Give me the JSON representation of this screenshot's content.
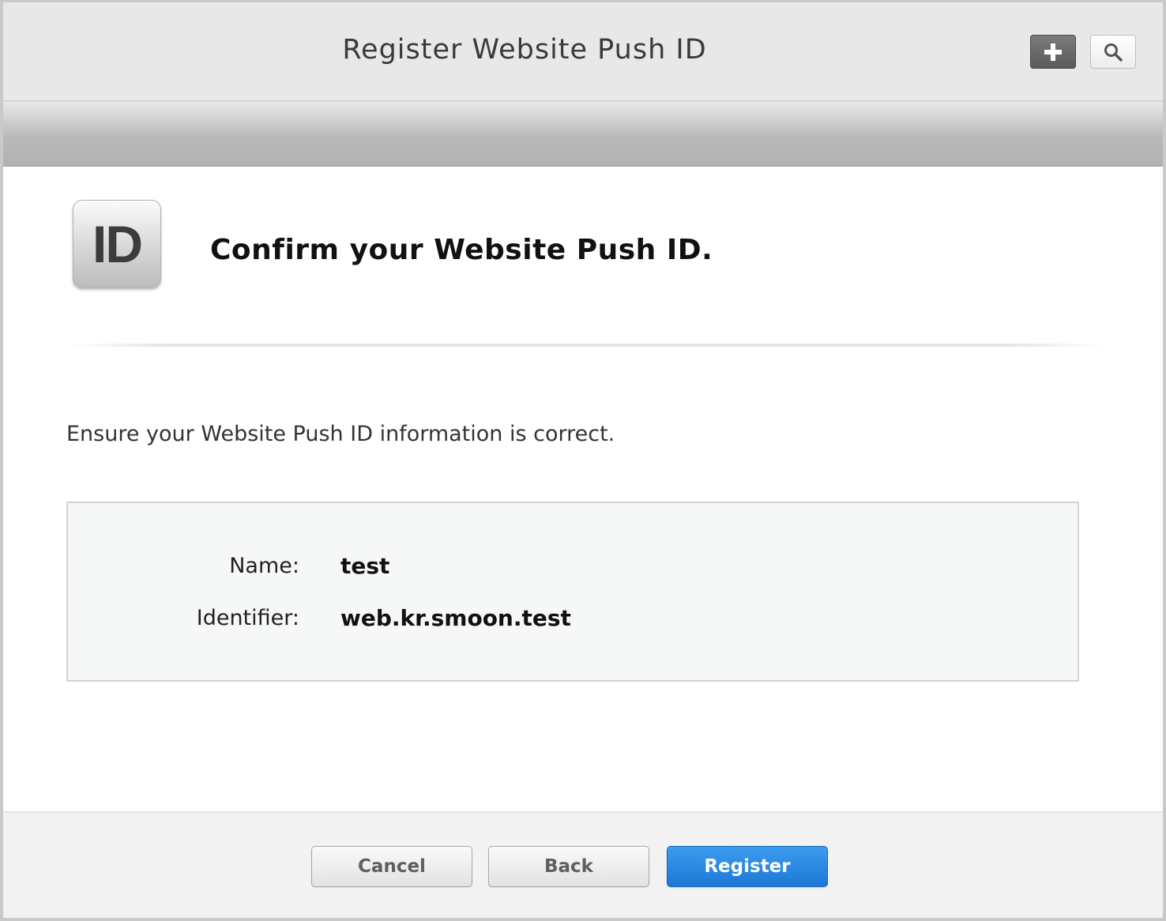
{
  "window": {
    "title": "Register Website Push ID"
  },
  "toolbar": {
    "add_icon": "plus-icon",
    "search_icon": "search-icon"
  },
  "main": {
    "badge_text": "ID",
    "heading": "Confirm your Website Push ID.",
    "intro": "Ensure your Website Push ID information is correct.",
    "details": [
      {
        "label": "Name:",
        "value": "test"
      },
      {
        "label": "Identifier:",
        "value": "web.kr.smoon.test"
      }
    ]
  },
  "footer": {
    "cancel_label": "Cancel",
    "back_label": "Back",
    "register_label": "Register"
  },
  "colors": {
    "primary_button": "#1c78d6",
    "title_bar": "#e8e8e8"
  }
}
